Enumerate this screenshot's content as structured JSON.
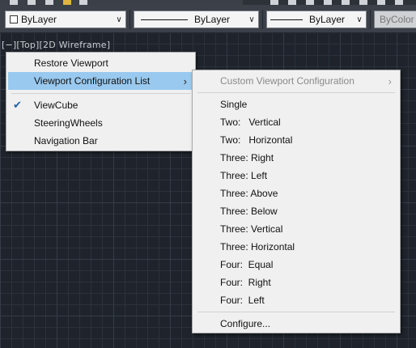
{
  "toolbar": {
    "layer_combo": "ByLayer",
    "linetype_combo": "ByLayer",
    "lineweight_combo": "ByLayer",
    "plotstyle_combo": "ByColor"
  },
  "viewport_label": "[−][Top][2D Wireframe]",
  "context_menu": {
    "items": [
      {
        "label": "Restore Viewport"
      },
      {
        "label": "Viewport Configuration List"
      },
      {
        "label": "ViewCube"
      },
      {
        "label": "SteeringWheels"
      },
      {
        "label": "Navigation Bar"
      }
    ]
  },
  "submenu": {
    "items": [
      {
        "label": "Custom Viewport Configuration"
      },
      {
        "label": "Single"
      },
      {
        "label": "Two:   Vertical"
      },
      {
        "label": "Two:   Horizontal"
      },
      {
        "label": "Three: Right"
      },
      {
        "label": "Three: Left"
      },
      {
        "label": "Three: Above"
      },
      {
        "label": "Three: Below"
      },
      {
        "label": "Three: Vertical"
      },
      {
        "label": "Three: Horizontal"
      },
      {
        "label": "Four:  Equal"
      },
      {
        "label": "Four:  Right"
      },
      {
        "label": "Four:  Left"
      },
      {
        "label": "Configure..."
      }
    ]
  },
  "colors": {
    "highlight": "#99c9ef",
    "check": "#1d5fa8",
    "canvas": "#1f242c"
  }
}
